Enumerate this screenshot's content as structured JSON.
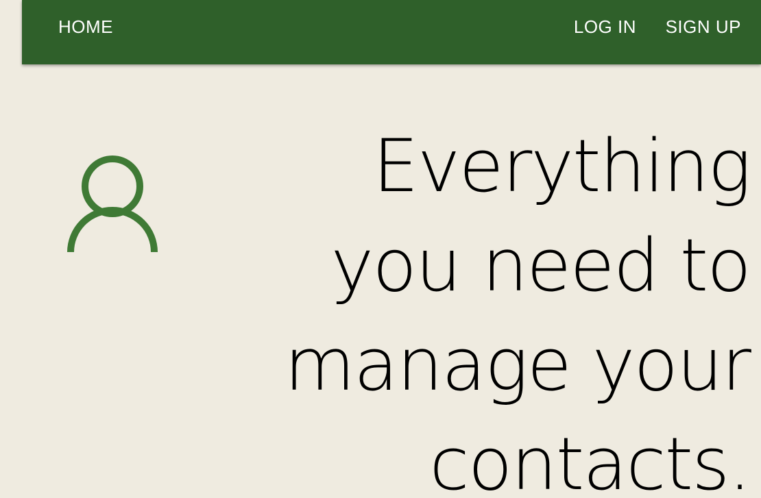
{
  "nav": {
    "home_label": "HOME",
    "login_label": "LOG IN",
    "signup_label": "SIGN UP"
  },
  "hero": {
    "icon": "user-icon",
    "headline": "Everything\nyou need to\nmanage your\ncontacts."
  },
  "colors": {
    "nav_background": "#2f602a",
    "page_background": "#efebe0",
    "icon": "#3f7a35",
    "headline": "#000000"
  }
}
